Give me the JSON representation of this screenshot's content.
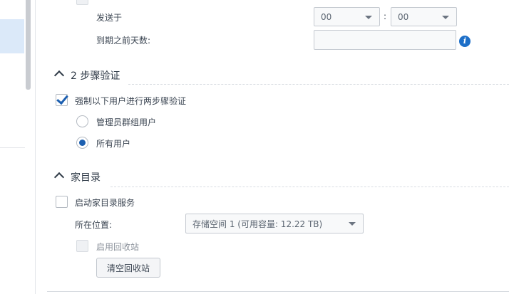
{
  "schedule": {
    "send_at_label": "发送于",
    "hour_value": "00",
    "separator": ":",
    "minute_value": "00",
    "days_before_label": "到期之前天数:",
    "days_before_value": "",
    "info_icon_glyph": "i"
  },
  "two_step": {
    "section_title": "2 步骤验证",
    "enforce_label": "强制以下用户进行两步骤验证",
    "enforce_checked": true,
    "options": [
      {
        "label": "管理员群组用户",
        "selected": false
      },
      {
        "label": "所有用户",
        "selected": true
      }
    ]
  },
  "home": {
    "section_title": "家目录",
    "enable_label": "启动家目录服务",
    "enable_checked": false,
    "location_label": "所在位置:",
    "location_value": "存储空间 1 (可用容量:  12.22 TB)",
    "recycle_label": "启用回收站",
    "empty_recycle_button": "清空回收站"
  },
  "colors": {
    "accent": "#1c5fb0",
    "info": "#1d6fc8",
    "sidebar_selected": "#dbe9f9"
  }
}
